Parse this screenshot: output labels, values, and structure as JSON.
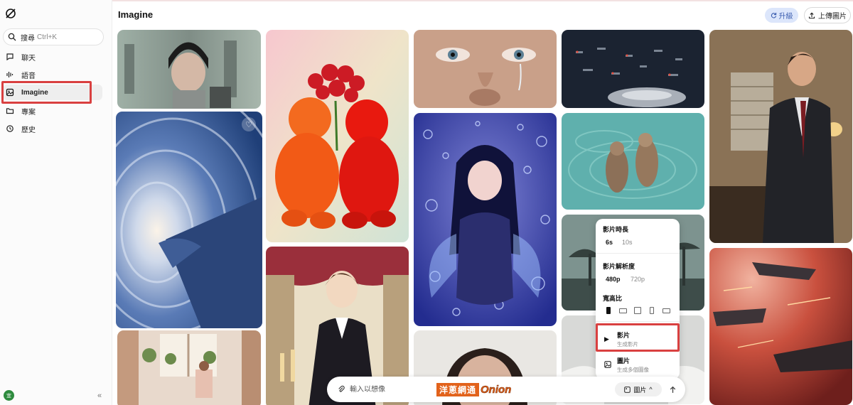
{
  "app": {
    "title": "Imagine"
  },
  "sidebar": {
    "search_label": "搜尋",
    "search_shortcut": "Ctrl+K",
    "items": [
      {
        "label": "聊天",
        "icon": "chat-icon"
      },
      {
        "label": "語音",
        "icon": "voice-icon"
      },
      {
        "label": "Imagine",
        "icon": "imagine-icon",
        "active": true
      },
      {
        "label": "專案",
        "icon": "folder-icon"
      },
      {
        "label": "歷史",
        "icon": "history-icon"
      }
    ],
    "avatar_initial": "宜",
    "collapse_glyph": "«"
  },
  "header": {
    "upgrade_label": "升級",
    "upload_label": "上傳圖片"
  },
  "popup": {
    "duration_label": "影片時長",
    "duration_options": [
      "6s",
      "10s"
    ],
    "duration_selected": "6s",
    "resolution_label": "影片解析度",
    "resolution_options": [
      "480p",
      "720p"
    ],
    "resolution_selected": "480p",
    "aspect_label": "寬高比",
    "aspect_selected_index": 0,
    "modes": [
      {
        "title": "影片",
        "subtitle": "生成影片",
        "icon": "play-icon"
      },
      {
        "title": "圖片",
        "subtitle": "生成多個圖像",
        "icon": "image-icon"
      }
    ]
  },
  "prompt": {
    "placeholder": "輸入以想像",
    "mode_label": "圖片",
    "mode_chevron": "^"
  },
  "watermark": {
    "cn": "洋蔥網通",
    "en": "Onion"
  },
  "colors": {
    "highlight": "#d94040",
    "accent": "#3d5fb0",
    "avatar": "#2e8b3e"
  }
}
